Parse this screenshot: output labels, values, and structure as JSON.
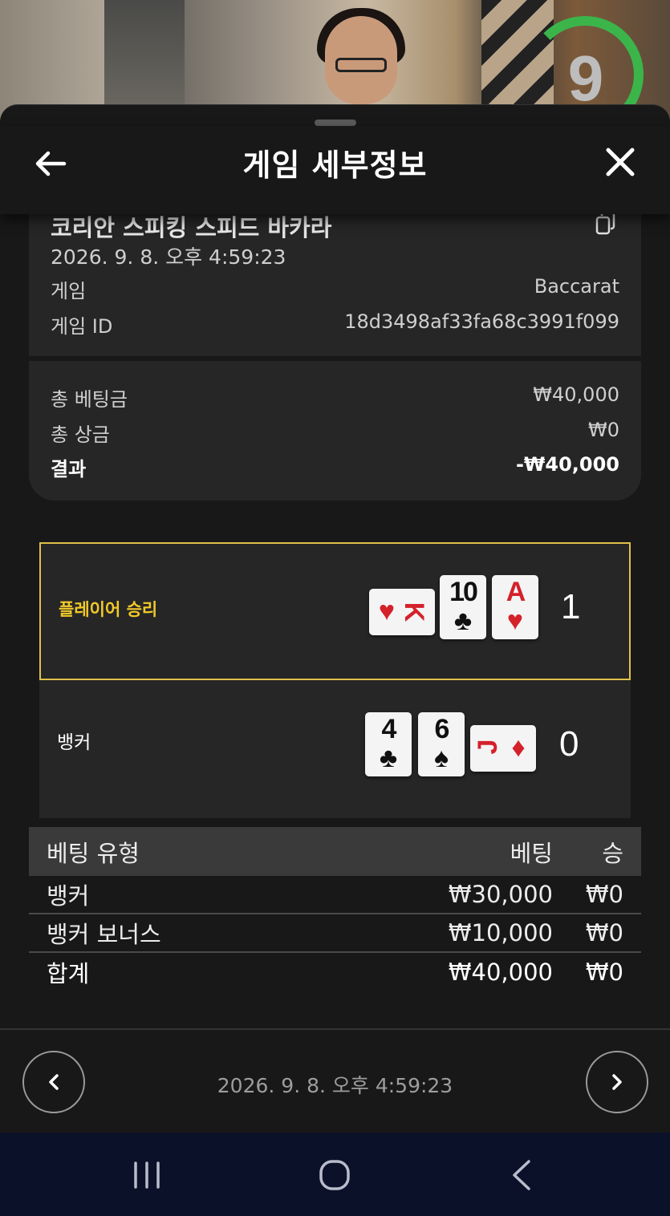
{
  "video": {
    "timer_value": "9"
  },
  "header": {
    "title": "게임 세부정보"
  },
  "info": {
    "game_name": "코리안 스피킹 스피드 바카라",
    "datetime": "2026. 9. 8. 오후 4:59:23",
    "game_label": "게임",
    "game_value": "Baccarat",
    "game_id_label": "게임 ID",
    "game_id_value": "18d3498af33fa68c3991f099",
    "total_bet_label": "총 베팅금",
    "total_bet_value": "₩40,000",
    "total_win_label": "총 상금",
    "total_win_value": "₩0",
    "result_label": "결과",
    "result_value": "-₩40,000"
  },
  "results": {
    "player": {
      "label": "플레이어 승리",
      "score": "1",
      "cards": [
        {
          "rank": "K",
          "suit": "♥",
          "color": "red",
          "sideways": true
        },
        {
          "rank": "10",
          "suit": "♣",
          "color": "black",
          "sideways": false
        },
        {
          "rank": "A",
          "suit": "♥",
          "color": "red",
          "sideways": false
        }
      ]
    },
    "banker": {
      "label": "뱅커",
      "score": "0",
      "cards": [
        {
          "rank": "4",
          "suit": "♣",
          "color": "black",
          "sideways": false
        },
        {
          "rank": "6",
          "suit": "♠",
          "color": "black",
          "sideways": false
        },
        {
          "rank": "J",
          "suit": "♦",
          "color": "red",
          "sideways": true
        }
      ]
    }
  },
  "bet_table": {
    "headers": [
      "베팅 유형",
      "베팅",
      "승"
    ],
    "rows": [
      [
        "뱅커",
        "₩30,000",
        "₩0"
      ],
      [
        "뱅커 보너스",
        "₩10,000",
        "₩0"
      ],
      [
        "합계",
        "₩40,000",
        "₩0"
      ]
    ]
  },
  "footer": {
    "datetime": "2026. 9. 8. 오후 4:59:23"
  },
  "colors": {
    "accent_gold": "#e0c14a",
    "timer_green": "#3bb54a",
    "card_red": "#d4212a"
  }
}
